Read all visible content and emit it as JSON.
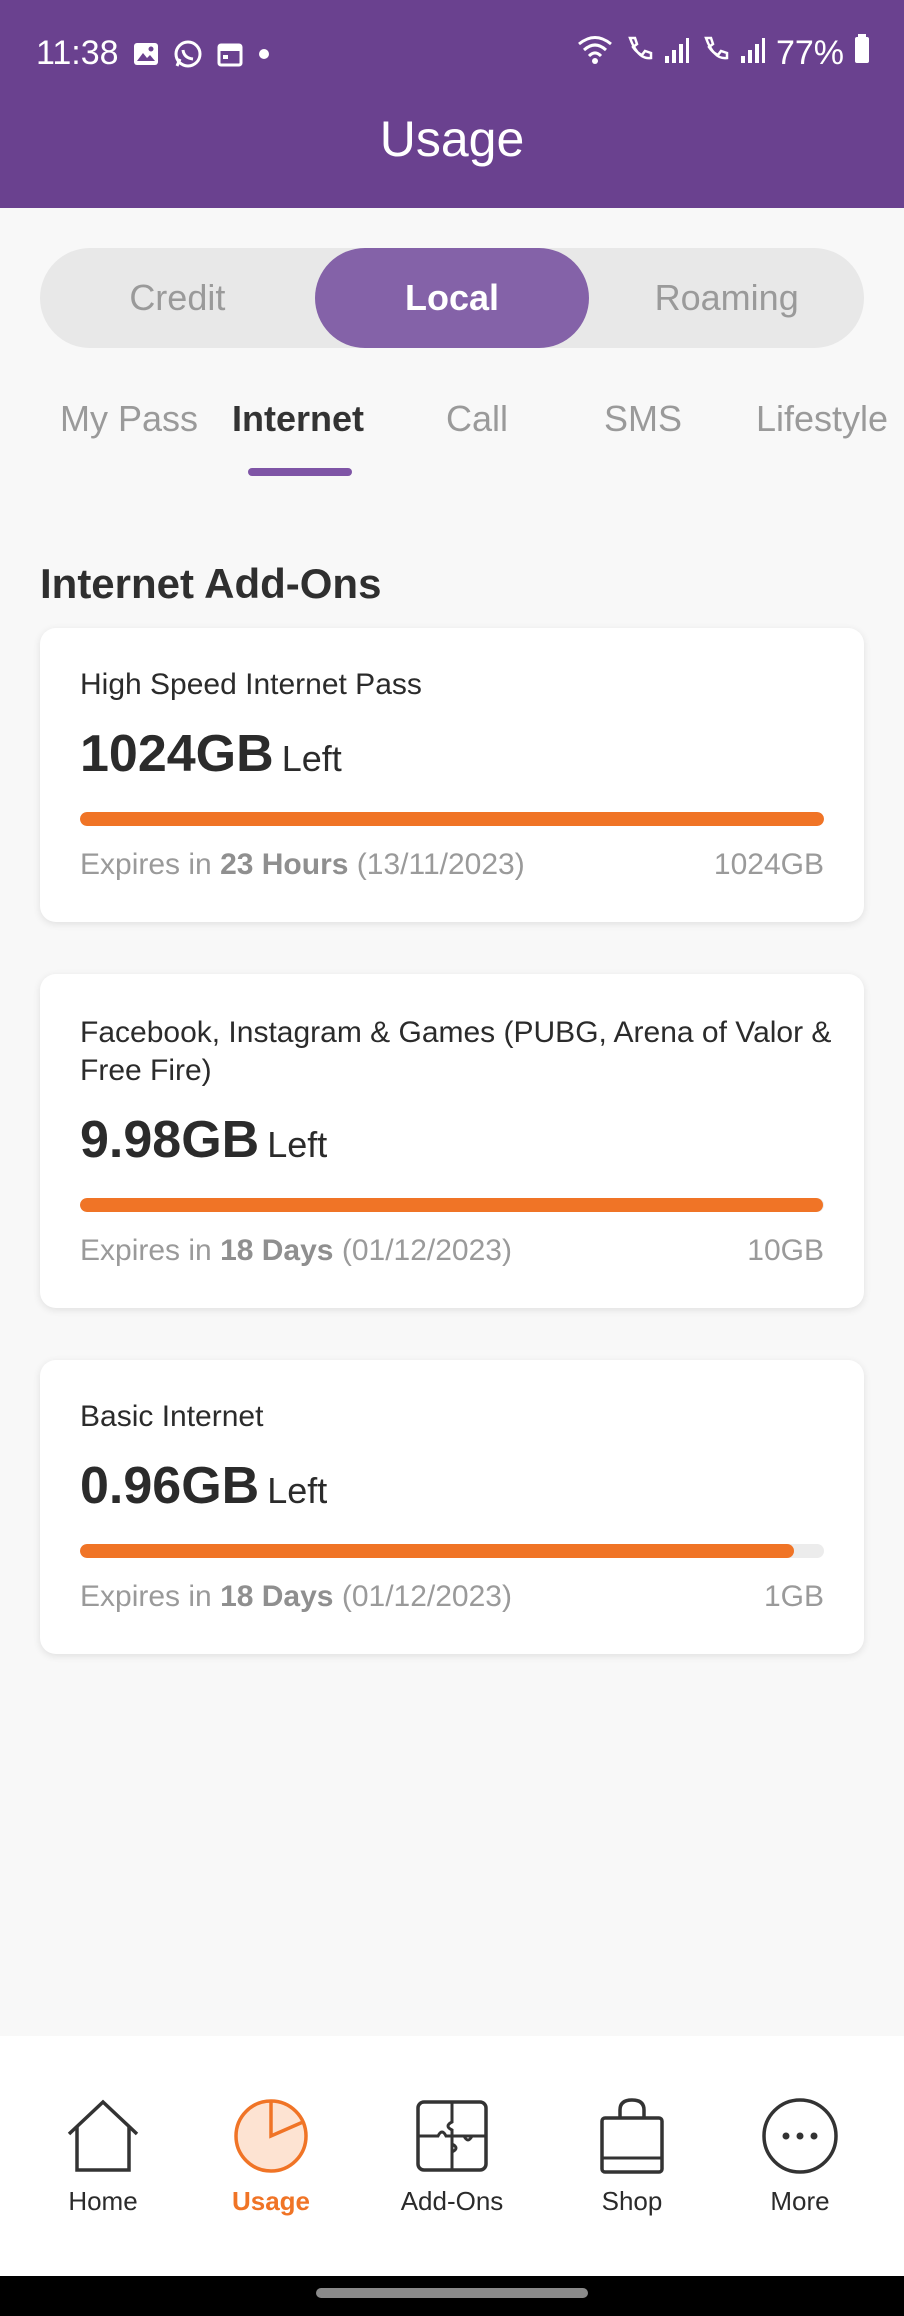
{
  "status_bar": {
    "time": "11:38",
    "battery": "77%"
  },
  "header": {
    "title": "Usage"
  },
  "segment": {
    "options": [
      "Credit",
      "Local",
      "Roaming"
    ],
    "selected": "Local"
  },
  "tabs": {
    "items": [
      "My Pass",
      "Internet",
      "Call",
      "SMS",
      "Lifestyle"
    ],
    "selected": "Internet"
  },
  "section_title": "Internet Add-Ons",
  "cards": [
    {
      "title": "High Speed Internet Pass",
      "remaining": "1024GB",
      "remaining_suffix": "Left",
      "fill_percent": 100,
      "expires_prefix": "Expires in ",
      "expires_bold": "23 Hours",
      "expires_date": " (13/11/2023)",
      "total": "1024GB"
    },
    {
      "title": "Facebook, Instagram & Games (PUBG, Arena of Valor & Free Fire)",
      "remaining": "9.98GB",
      "remaining_suffix": "Left",
      "fill_percent": 99.8,
      "expires_prefix": "Expires in ",
      "expires_bold": "18 Days",
      "expires_date": " (01/12/2023)",
      "total": "10GB"
    },
    {
      "title": "Basic Internet",
      "remaining": "0.96GB",
      "remaining_suffix": "Left",
      "fill_percent": 96,
      "expires_prefix": "Expires in ",
      "expires_bold": "18 Days",
      "expires_date": " (01/12/2023)",
      "total": "1GB"
    }
  ],
  "bottom_nav": {
    "items": [
      {
        "label": "Home",
        "icon": "home-icon"
      },
      {
        "label": "Usage",
        "icon": "usage-pie-icon"
      },
      {
        "label": "Add-Ons",
        "icon": "puzzle-icon"
      },
      {
        "label": "Shop",
        "icon": "shopping-bag-icon"
      },
      {
        "label": "More",
        "icon": "more-dots-icon"
      }
    ],
    "selected": "Usage"
  },
  "colors": {
    "header_purple": "#6a418f",
    "segment_active": "#8462a8",
    "accent_orange": "#f07426"
  }
}
